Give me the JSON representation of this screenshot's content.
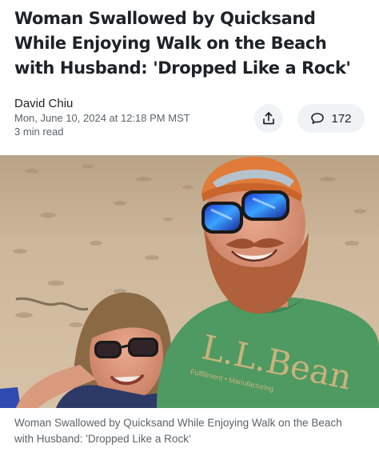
{
  "article": {
    "headline_lines": [
      "Woman Swallowed by Quicksand",
      "While Enjoying Walk on the Beach",
      "with Husband: 'Dropped Like a Rock'"
    ],
    "author": "David Chiu",
    "timestamp": "Mon, June 10, 2024 at 12:18 PM MST",
    "read_time": "3 min read",
    "comment_count": "172",
    "photo": {
      "shirt_brand": "L.L.Bean",
      "shirt_subtext": "Fulfillment • Manufacturing"
    },
    "caption_lines": [
      "Woman Swallowed by Quicksand While Enjoying Walk on the Beach",
      "with Husband: 'Dropped Like a Rock'"
    ]
  },
  "icons": {
    "share": "share-icon",
    "comments": "comment-icon"
  },
  "colors": {
    "text": "#1d2228",
    "muted": "#5b636a",
    "button_bg": "#f0f3f5",
    "shirt_green": "#4f9a62",
    "sand": "#cbb394",
    "beard": "#b0603a",
    "cap_orange": "#e07b3a"
  }
}
